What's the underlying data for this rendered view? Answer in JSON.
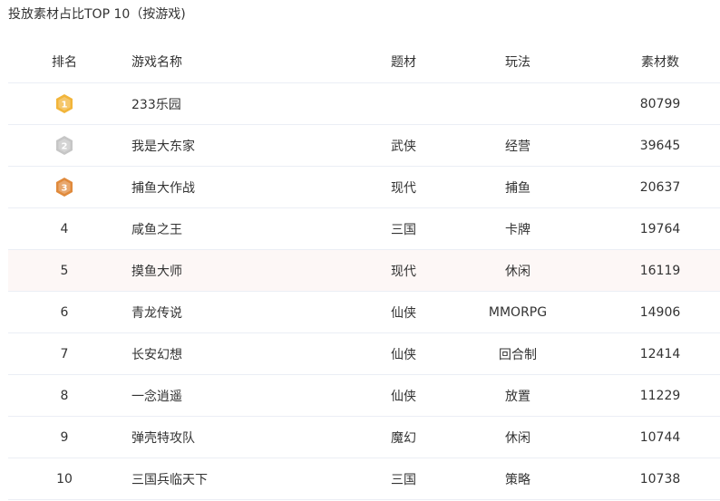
{
  "title": "投放素材占比TOP 10（按游戏)",
  "headers": {
    "rank": "排名",
    "name": "游戏名称",
    "theme": "题材",
    "play": "玩法",
    "count": "素材数"
  },
  "medal_colors": [
    "#f2b53a",
    "#c6c6c6",
    "#e08a3c"
  ],
  "rows": [
    {
      "rank": "1",
      "name": "233乐园",
      "theme": "",
      "play": "",
      "count": "80799"
    },
    {
      "rank": "2",
      "name": "我是大东家",
      "theme": "武侠",
      "play": "经营",
      "count": "39645"
    },
    {
      "rank": "3",
      "name": "捕鱼大作战",
      "theme": "现代",
      "play": "捕鱼",
      "count": "20637"
    },
    {
      "rank": "4",
      "name": "咸鱼之王",
      "theme": "三国",
      "play": "卡牌",
      "count": "19764"
    },
    {
      "rank": "5",
      "name": "摸鱼大师",
      "theme": "现代",
      "play": "休闲",
      "count": "16119"
    },
    {
      "rank": "6",
      "name": "青龙传说",
      "theme": "仙侠",
      "play": "MMORPG",
      "count": "14906"
    },
    {
      "rank": "7",
      "name": "长安幻想",
      "theme": "仙侠",
      "play": "回合制",
      "count": "12414"
    },
    {
      "rank": "8",
      "name": "一念逍遥",
      "theme": "仙侠",
      "play": "放置",
      "count": "11229"
    },
    {
      "rank": "9",
      "name": "弹壳特攻队",
      "theme": "魔幻",
      "play": "休闲",
      "count": "10744"
    },
    {
      "rank": "10",
      "name": "三国兵临天下",
      "theme": "三国",
      "play": "策略",
      "count": "10738"
    }
  ]
}
